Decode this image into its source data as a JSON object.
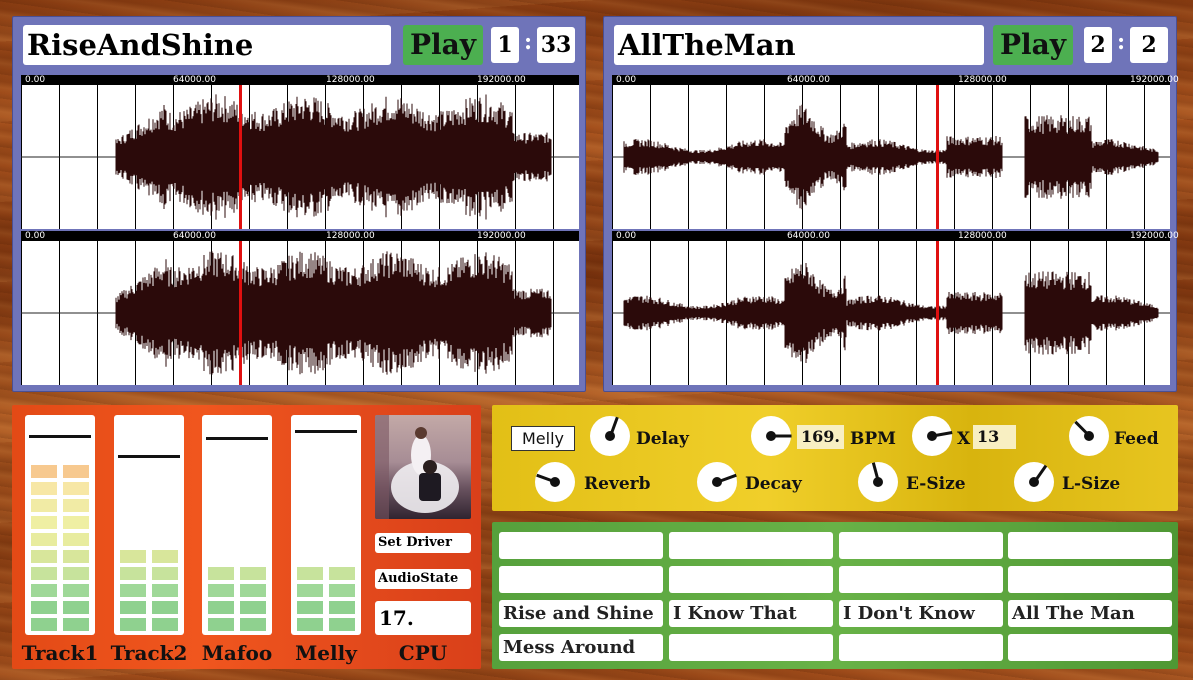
{
  "decks": [
    {
      "title": "RiseAndShine",
      "play_label": "Play",
      "counter_a": "1",
      "counter_b": "33",
      "ruler_ticks": [
        "0.00",
        "64000.00",
        "128000.00",
        "192000.00"
      ],
      "ruler_ticks_bottom": [
        "0.00",
        "64000.00",
        "128000.00",
        "192000.00"
      ],
      "playhead_fraction": 0.39,
      "color_accent": "#4caf50"
    },
    {
      "title": "AllTheMan",
      "play_label": "Play",
      "counter_a": "2",
      "counter_b": "2",
      "ruler_ticks": [
        "0.00",
        "64000.00",
        "128000.00",
        "192000.00"
      ],
      "ruler_ticks_bottom": [
        "0.00",
        "64000.00",
        "128000.00",
        "192000.00"
      ],
      "playhead_fraction": 0.58,
      "color_accent": "#4caf50"
    }
  ],
  "mixer": {
    "channels": [
      {
        "label": "Track1",
        "level": 0.95,
        "fader": 0.91
      },
      {
        "label": "Track2",
        "level": 0.5,
        "fader": 0.82
      },
      {
        "label": "Mafoo",
        "level": 0.35,
        "fader": 0.9
      },
      {
        "label": "Melly",
        "level": 0.35,
        "fader": 0.93
      }
    ],
    "album_icon": "album-cover-image",
    "set_driver_label": "Set Driver",
    "audio_state_label": "AudioState",
    "cpu_value": "17.",
    "cpu_label": "CPU"
  },
  "fx": {
    "channel_name": "Melly",
    "bpm_value": "169.",
    "x_value": "13",
    "knobs": {
      "delay": "Delay",
      "bpm": "BPM",
      "x": "X",
      "feed": "Feed",
      "reverb": "Reverb",
      "decay": "Decay",
      "esize": "E-Size",
      "lsize": "L-Size"
    }
  },
  "clips": [
    [
      "",
      "",
      "",
      ""
    ],
    [
      "",
      "",
      "",
      ""
    ],
    [
      "Rise and Shine",
      "I Know That",
      "I Don't Know",
      "All The Man"
    ],
    [
      "Mess Around",
      "",
      "",
      ""
    ]
  ]
}
